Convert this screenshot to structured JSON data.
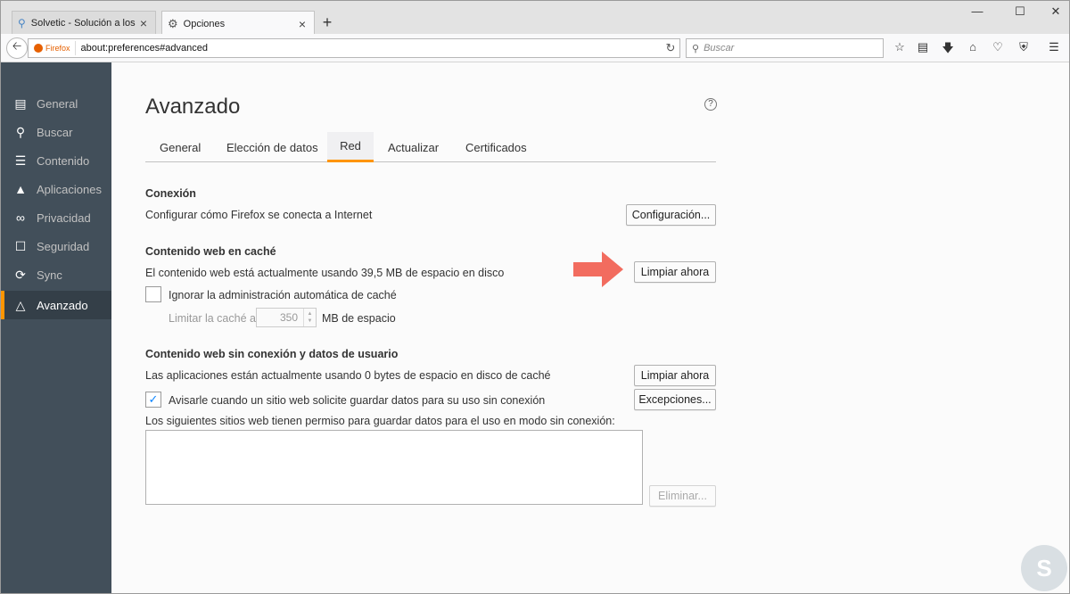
{
  "browser": {
    "tabs": [
      {
        "title": "Solvetic - Solución a los prol"
      },
      {
        "title": "Opciones"
      }
    ],
    "new_tab": "+",
    "url_identity": "Firefox",
    "url": "about:preferences#advanced",
    "search_placeholder": "Buscar"
  },
  "sidebar": {
    "items": [
      {
        "label": "General",
        "icon": "general-icon"
      },
      {
        "label": "Buscar",
        "icon": "search-icon"
      },
      {
        "label": "Contenido",
        "icon": "content-icon"
      },
      {
        "label": "Aplicaciones",
        "icon": "applications-icon"
      },
      {
        "label": "Privacidad",
        "icon": "privacy-mask-icon"
      },
      {
        "label": "Seguridad",
        "icon": "security-lock-icon"
      },
      {
        "label": "Sync",
        "icon": "sync-icon"
      },
      {
        "label": "Avanzado",
        "icon": "advanced-wizard-hat-icon"
      }
    ],
    "active": "Avanzado"
  },
  "page": {
    "title": "Avanzado",
    "help": "?",
    "tabs": [
      "General",
      "Elección de datos",
      "Red",
      "Actualizar",
      "Certificados"
    ],
    "selected_tab": "Red",
    "connection": {
      "heading": "Conexión",
      "text": "Configurar cómo Firefox se conecta a Internet",
      "button": "Configuración..."
    },
    "cache": {
      "heading": "Contenido web en caché",
      "text": "El contenido web está actualmente usando 39,5 MB de espacio en disco",
      "button": "Limpiar ahora",
      "override_label": "Ignorar la administración automática de caché",
      "override_checked": false,
      "limit_label": "Limitar la caché a",
      "limit_value": "350",
      "limit_unit": "MB de espacio"
    },
    "offline": {
      "heading": "Contenido web sin conexión y datos de usuario",
      "text": "Las aplicaciones están actualmente usando 0 bytes de espacio en disco de caché",
      "button": "Limpiar ahora",
      "notify_label": "Avisarle cuando un sitio web solicite guardar datos para su uso sin conexión",
      "notify_checked": true,
      "exceptions_button": "Excepciones...",
      "list_label": "Los siguientes sitios web tienen permiso para guardar datos para el uso en modo sin conexión:",
      "remove_button": "Eliminar..."
    }
  },
  "colors": {
    "sidebar_bg": "#424f5a",
    "accent": "#ff9500",
    "arrow": "#f26c5f"
  }
}
